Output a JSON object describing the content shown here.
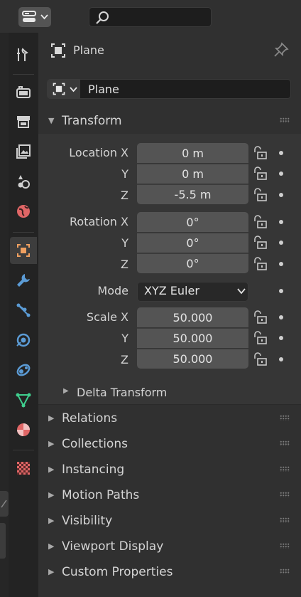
{
  "header": {
    "editor_type_icon": "properties-editor-icon",
    "search_icon": "search-icon",
    "search_placeholder": ""
  },
  "tabs": [
    {
      "name": "tool",
      "icon": "tool-icon",
      "color": "#d0d0d0",
      "active": false
    },
    {
      "name": "render",
      "icon": "render-icon",
      "color": "#d0d0d0",
      "active": false
    },
    {
      "name": "output",
      "icon": "output-icon",
      "color": "#d0d0d0",
      "active": false
    },
    {
      "name": "view-layer",
      "icon": "view-layer-icon",
      "color": "#d0d0d0",
      "active": false
    },
    {
      "name": "scene",
      "icon": "scene-icon",
      "color": "#d0d0d0",
      "active": false
    },
    {
      "name": "world",
      "icon": "world-icon",
      "color": "#e06666",
      "active": false
    },
    {
      "name": "object",
      "icon": "object-icon",
      "color": "#f0a060",
      "active": true
    },
    {
      "name": "modifiers",
      "icon": "wrench-icon",
      "color": "#5b9bd5",
      "active": false
    },
    {
      "name": "particles",
      "icon": "particles-icon",
      "color": "#5b9bd5",
      "active": false
    },
    {
      "name": "physics",
      "icon": "physics-icon",
      "color": "#5b9bd5",
      "active": false
    },
    {
      "name": "constraints",
      "icon": "constraints-icon",
      "color": "#5b9bd5",
      "active": false
    },
    {
      "name": "data",
      "icon": "mesh-data-icon",
      "color": "#3fcf8e",
      "active": false
    },
    {
      "name": "material",
      "icon": "material-icon",
      "color": "#e06666",
      "active": false
    },
    {
      "name": "texture",
      "icon": "texture-icon",
      "color": "#e06666",
      "active": false
    }
  ],
  "object": {
    "name": "Plane",
    "datablock_name": "Plane"
  },
  "transform": {
    "title": "Transform",
    "location": {
      "label_x": "Location X",
      "label_y": "Y",
      "label_z": "Z",
      "x": "0 m",
      "y": "0 m",
      "z": "-5.5 m"
    },
    "rotation": {
      "label_x": "Rotation X",
      "label_y": "Y",
      "label_z": "Z",
      "x": "0°",
      "y": "0°",
      "z": "0°"
    },
    "mode": {
      "label": "Mode",
      "value": "XYZ Euler"
    },
    "scale": {
      "label_x": "Scale X",
      "label_y": "Y",
      "label_z": "Z",
      "x": "50.000",
      "y": "50.000",
      "z": "50.000"
    },
    "delta_title": "Delta Transform"
  },
  "panels": [
    {
      "title": "Relations"
    },
    {
      "title": "Collections"
    },
    {
      "title": "Instancing"
    },
    {
      "title": "Motion Paths"
    },
    {
      "title": "Visibility"
    },
    {
      "title": "Viewport Display"
    },
    {
      "title": "Custom Properties"
    }
  ],
  "colors": {
    "background": "#303030",
    "panel_body": "#363636",
    "field": "#545454",
    "active_tab_icon": "#f0a060"
  }
}
